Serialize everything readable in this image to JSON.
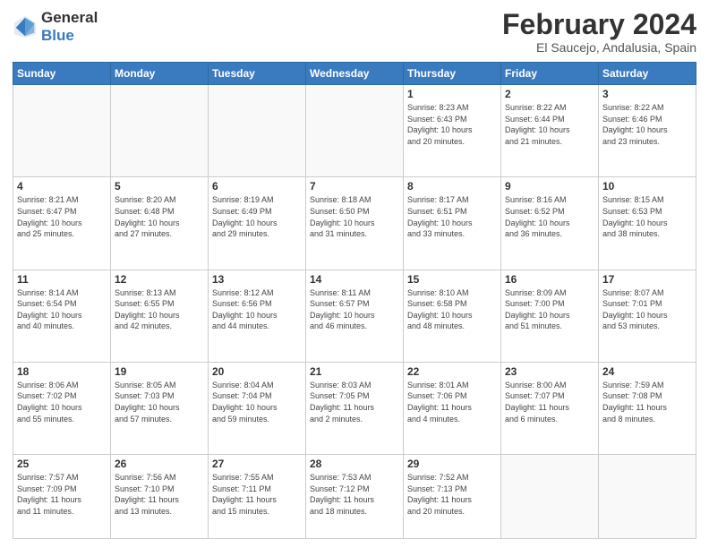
{
  "header": {
    "logo_line1": "General",
    "logo_line2": "Blue",
    "month_year": "February 2024",
    "location": "El Saucejo, Andalusia, Spain"
  },
  "weekdays": [
    "Sunday",
    "Monday",
    "Tuesday",
    "Wednesday",
    "Thursday",
    "Friday",
    "Saturday"
  ],
  "weeks": [
    [
      {
        "day": "",
        "info": ""
      },
      {
        "day": "",
        "info": ""
      },
      {
        "day": "",
        "info": ""
      },
      {
        "day": "",
        "info": ""
      },
      {
        "day": "1",
        "info": "Sunrise: 8:23 AM\nSunset: 6:43 PM\nDaylight: 10 hours\nand 20 minutes."
      },
      {
        "day": "2",
        "info": "Sunrise: 8:22 AM\nSunset: 6:44 PM\nDaylight: 10 hours\nand 21 minutes."
      },
      {
        "day": "3",
        "info": "Sunrise: 8:22 AM\nSunset: 6:46 PM\nDaylight: 10 hours\nand 23 minutes."
      }
    ],
    [
      {
        "day": "4",
        "info": "Sunrise: 8:21 AM\nSunset: 6:47 PM\nDaylight: 10 hours\nand 25 minutes."
      },
      {
        "day": "5",
        "info": "Sunrise: 8:20 AM\nSunset: 6:48 PM\nDaylight: 10 hours\nand 27 minutes."
      },
      {
        "day": "6",
        "info": "Sunrise: 8:19 AM\nSunset: 6:49 PM\nDaylight: 10 hours\nand 29 minutes."
      },
      {
        "day": "7",
        "info": "Sunrise: 8:18 AM\nSunset: 6:50 PM\nDaylight: 10 hours\nand 31 minutes."
      },
      {
        "day": "8",
        "info": "Sunrise: 8:17 AM\nSunset: 6:51 PM\nDaylight: 10 hours\nand 33 minutes."
      },
      {
        "day": "9",
        "info": "Sunrise: 8:16 AM\nSunset: 6:52 PM\nDaylight: 10 hours\nand 36 minutes."
      },
      {
        "day": "10",
        "info": "Sunrise: 8:15 AM\nSunset: 6:53 PM\nDaylight: 10 hours\nand 38 minutes."
      }
    ],
    [
      {
        "day": "11",
        "info": "Sunrise: 8:14 AM\nSunset: 6:54 PM\nDaylight: 10 hours\nand 40 minutes."
      },
      {
        "day": "12",
        "info": "Sunrise: 8:13 AM\nSunset: 6:55 PM\nDaylight: 10 hours\nand 42 minutes."
      },
      {
        "day": "13",
        "info": "Sunrise: 8:12 AM\nSunset: 6:56 PM\nDaylight: 10 hours\nand 44 minutes."
      },
      {
        "day": "14",
        "info": "Sunrise: 8:11 AM\nSunset: 6:57 PM\nDaylight: 10 hours\nand 46 minutes."
      },
      {
        "day": "15",
        "info": "Sunrise: 8:10 AM\nSunset: 6:58 PM\nDaylight: 10 hours\nand 48 minutes."
      },
      {
        "day": "16",
        "info": "Sunrise: 8:09 AM\nSunset: 7:00 PM\nDaylight: 10 hours\nand 51 minutes."
      },
      {
        "day": "17",
        "info": "Sunrise: 8:07 AM\nSunset: 7:01 PM\nDaylight: 10 hours\nand 53 minutes."
      }
    ],
    [
      {
        "day": "18",
        "info": "Sunrise: 8:06 AM\nSunset: 7:02 PM\nDaylight: 10 hours\nand 55 minutes."
      },
      {
        "day": "19",
        "info": "Sunrise: 8:05 AM\nSunset: 7:03 PM\nDaylight: 10 hours\nand 57 minutes."
      },
      {
        "day": "20",
        "info": "Sunrise: 8:04 AM\nSunset: 7:04 PM\nDaylight: 10 hours\nand 59 minutes."
      },
      {
        "day": "21",
        "info": "Sunrise: 8:03 AM\nSunset: 7:05 PM\nDaylight: 11 hours\nand 2 minutes."
      },
      {
        "day": "22",
        "info": "Sunrise: 8:01 AM\nSunset: 7:06 PM\nDaylight: 11 hours\nand 4 minutes."
      },
      {
        "day": "23",
        "info": "Sunrise: 8:00 AM\nSunset: 7:07 PM\nDaylight: 11 hours\nand 6 minutes."
      },
      {
        "day": "24",
        "info": "Sunrise: 7:59 AM\nSunset: 7:08 PM\nDaylight: 11 hours\nand 8 minutes."
      }
    ],
    [
      {
        "day": "25",
        "info": "Sunrise: 7:57 AM\nSunset: 7:09 PM\nDaylight: 11 hours\nand 11 minutes."
      },
      {
        "day": "26",
        "info": "Sunrise: 7:56 AM\nSunset: 7:10 PM\nDaylight: 11 hours\nand 13 minutes."
      },
      {
        "day": "27",
        "info": "Sunrise: 7:55 AM\nSunset: 7:11 PM\nDaylight: 11 hours\nand 15 minutes."
      },
      {
        "day": "28",
        "info": "Sunrise: 7:53 AM\nSunset: 7:12 PM\nDaylight: 11 hours\nand 18 minutes."
      },
      {
        "day": "29",
        "info": "Sunrise: 7:52 AM\nSunset: 7:13 PM\nDaylight: 11 hours\nand 20 minutes."
      },
      {
        "day": "",
        "info": ""
      },
      {
        "day": "",
        "info": ""
      }
    ]
  ]
}
